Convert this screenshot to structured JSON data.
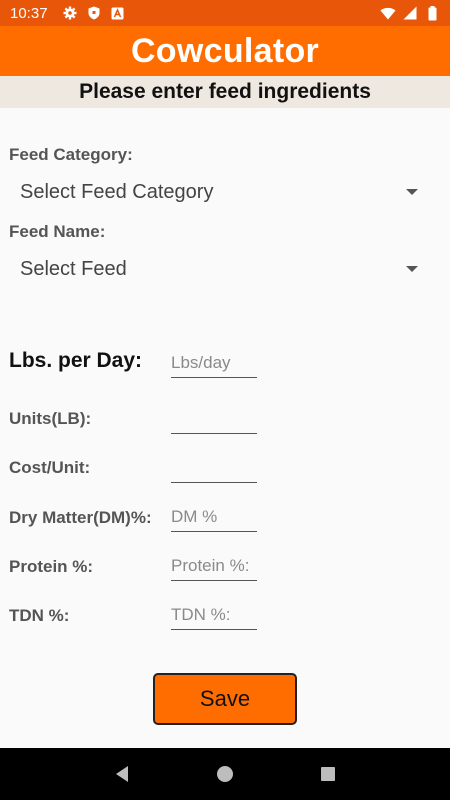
{
  "status_bar": {
    "time": "10:37",
    "left_icons": [
      "gear-icon",
      "shield-icon",
      "a-icon"
    ],
    "right_icons": [
      "wifi-icon",
      "signal-icon",
      "battery-icon"
    ]
  },
  "app_bar": {
    "title": "Cowculator",
    "color": "#ff6d00"
  },
  "subtitle": "Please enter feed ingredients",
  "form": {
    "feed_category_label": "Feed Category:",
    "feed_category_value": "Select Feed Category",
    "feed_name_label": "Feed Name:",
    "feed_name_value": "Select Feed",
    "lbs_per_day_label": "Lbs. per Day:",
    "lbs_per_day_placeholder": "Lbs/day",
    "units_label": "Units(LB):",
    "units_value": "",
    "cost_label": "Cost/Unit:",
    "cost_value": "",
    "dm_label": "Dry Matter(DM)%:",
    "dm_placeholder": "DM %",
    "protein_label": "Protein %:",
    "protein_placeholder": "Protein %:",
    "tdn_label": "TDN %:",
    "tdn_placeholder": "TDN %:"
  },
  "save_button": {
    "label": "Save"
  },
  "nav_bar": {
    "icons": [
      "back-icon",
      "home-icon",
      "recents-icon"
    ]
  }
}
